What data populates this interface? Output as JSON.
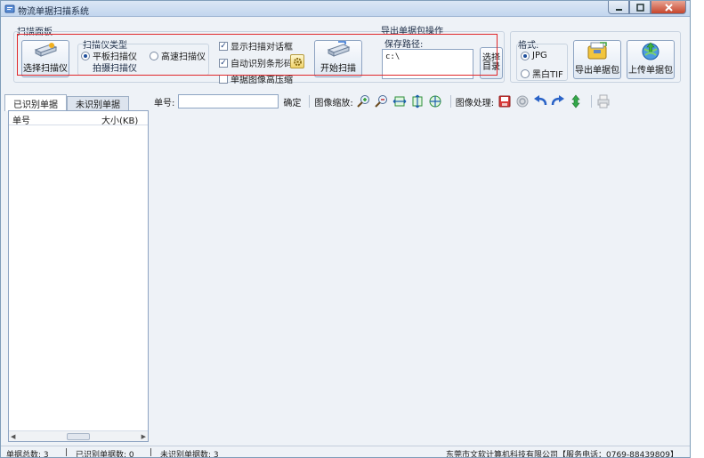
{
  "window": {
    "title": "物流单据扫描系统"
  },
  "scan_panel": {
    "label": "扫描面板",
    "select_scanner_label": "选择扫描仪",
    "scanner_type_label": "扫描仪类型",
    "scanner_types": [
      {
        "label": "平板扫描仪",
        "selected": true
      },
      {
        "label": "高速扫描仪",
        "selected": false
      }
    ],
    "camera_scanner_label": "拍摄扫描仪",
    "options": [
      {
        "label": "显示扫描对话框",
        "checked": true
      },
      {
        "label": "自动识别条形码",
        "checked": true
      },
      {
        "label": "单据图像高压缩",
        "checked": false
      }
    ],
    "start_scan_label": "开始扫描"
  },
  "export_panel": {
    "label": "导出单据包操作",
    "save_path_label": "保存路径:",
    "save_path_value": "c:\\",
    "choose_dir_label": "选择目录"
  },
  "format_panel": {
    "label": "格式:",
    "formats": [
      {
        "label": "JPG",
        "selected": true
      },
      {
        "label": "黑白TIF",
        "selected": false
      }
    ],
    "export_pkg_label": "导出单据包",
    "upload_pkg_label": "上传单据包"
  },
  "tabs": [
    {
      "label": "已识别单据",
      "active": true
    },
    {
      "label": "未识别单据",
      "active": false
    }
  ],
  "list": {
    "columns": [
      "单号",
      "大小(KB)"
    ],
    "rows": []
  },
  "viewer_toolbar": {
    "order_no_label": "单号:",
    "order_no_value": "",
    "confirm_label": "确定",
    "zoom_label": "图像缩放:",
    "process_label": "图像处理:"
  },
  "status": {
    "total": "单据总数:  3",
    "recognized": "已识别单据数:  0",
    "unrecognized": "未识别单据数:  3",
    "company": "东莞市文软计算机科技有限公司【服务电话：0769-88439809】"
  },
  "colors": {
    "accent": "#1e4f9c",
    "highlight_frame": "#e0282b",
    "close_button": "#c6452c",
    "window_bg": "#eef2f7"
  }
}
